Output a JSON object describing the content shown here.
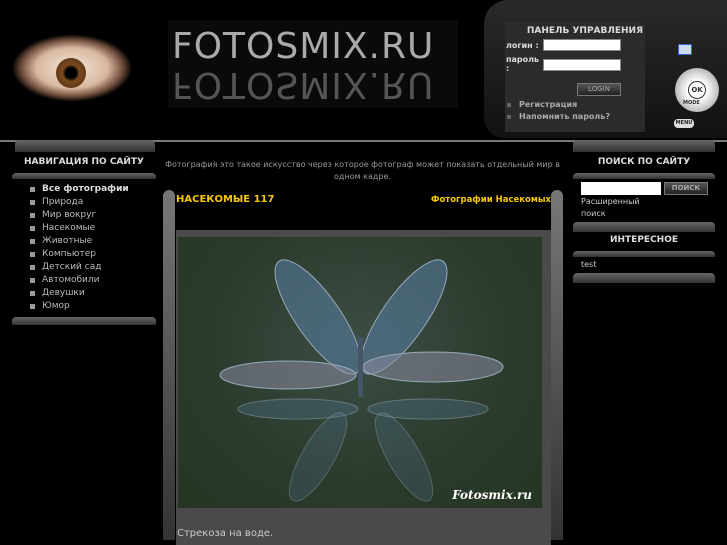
{
  "header": {
    "logo": "FOTOSMIX.RU"
  },
  "login": {
    "title": "ПАНЕЛЬ УПРАВЛЕНИЯ",
    "login_label": "логин :",
    "password_label": "пароль :",
    "button": "LOGIN",
    "links": [
      "Регистрация",
      "Напомнить пароль?"
    ]
  },
  "camera": {
    "ok": "OK",
    "mode": "MODE",
    "menu": "MENU"
  },
  "nav": {
    "title": "НАВИГАЦИЯ ПО САЙТУ",
    "items": [
      "Все фотографии",
      "Природа",
      "Мир вокруг",
      "Насекомые",
      "Животные",
      "Компьютер",
      "Детский сад",
      "Автомобили",
      "Девушки",
      "Юмор"
    ]
  },
  "main": {
    "intro": "Фотография это такое искусство через которое фотограф может показать отдельный мир в одном кадре.",
    "category": "НАСЕКОМЫЕ 117",
    "category_link": "Фотографии Насекомых",
    "watermark": "Fotosmix.ru",
    "caption": "Стрекоза на воде."
  },
  "search": {
    "title": "ПОИСК ПО САЙТУ",
    "button": "ПОИСК",
    "advanced": "Расширенный поиск"
  },
  "interesting": {
    "title": "ИНТЕРЕСНОЕ",
    "items": [
      "test"
    ]
  }
}
